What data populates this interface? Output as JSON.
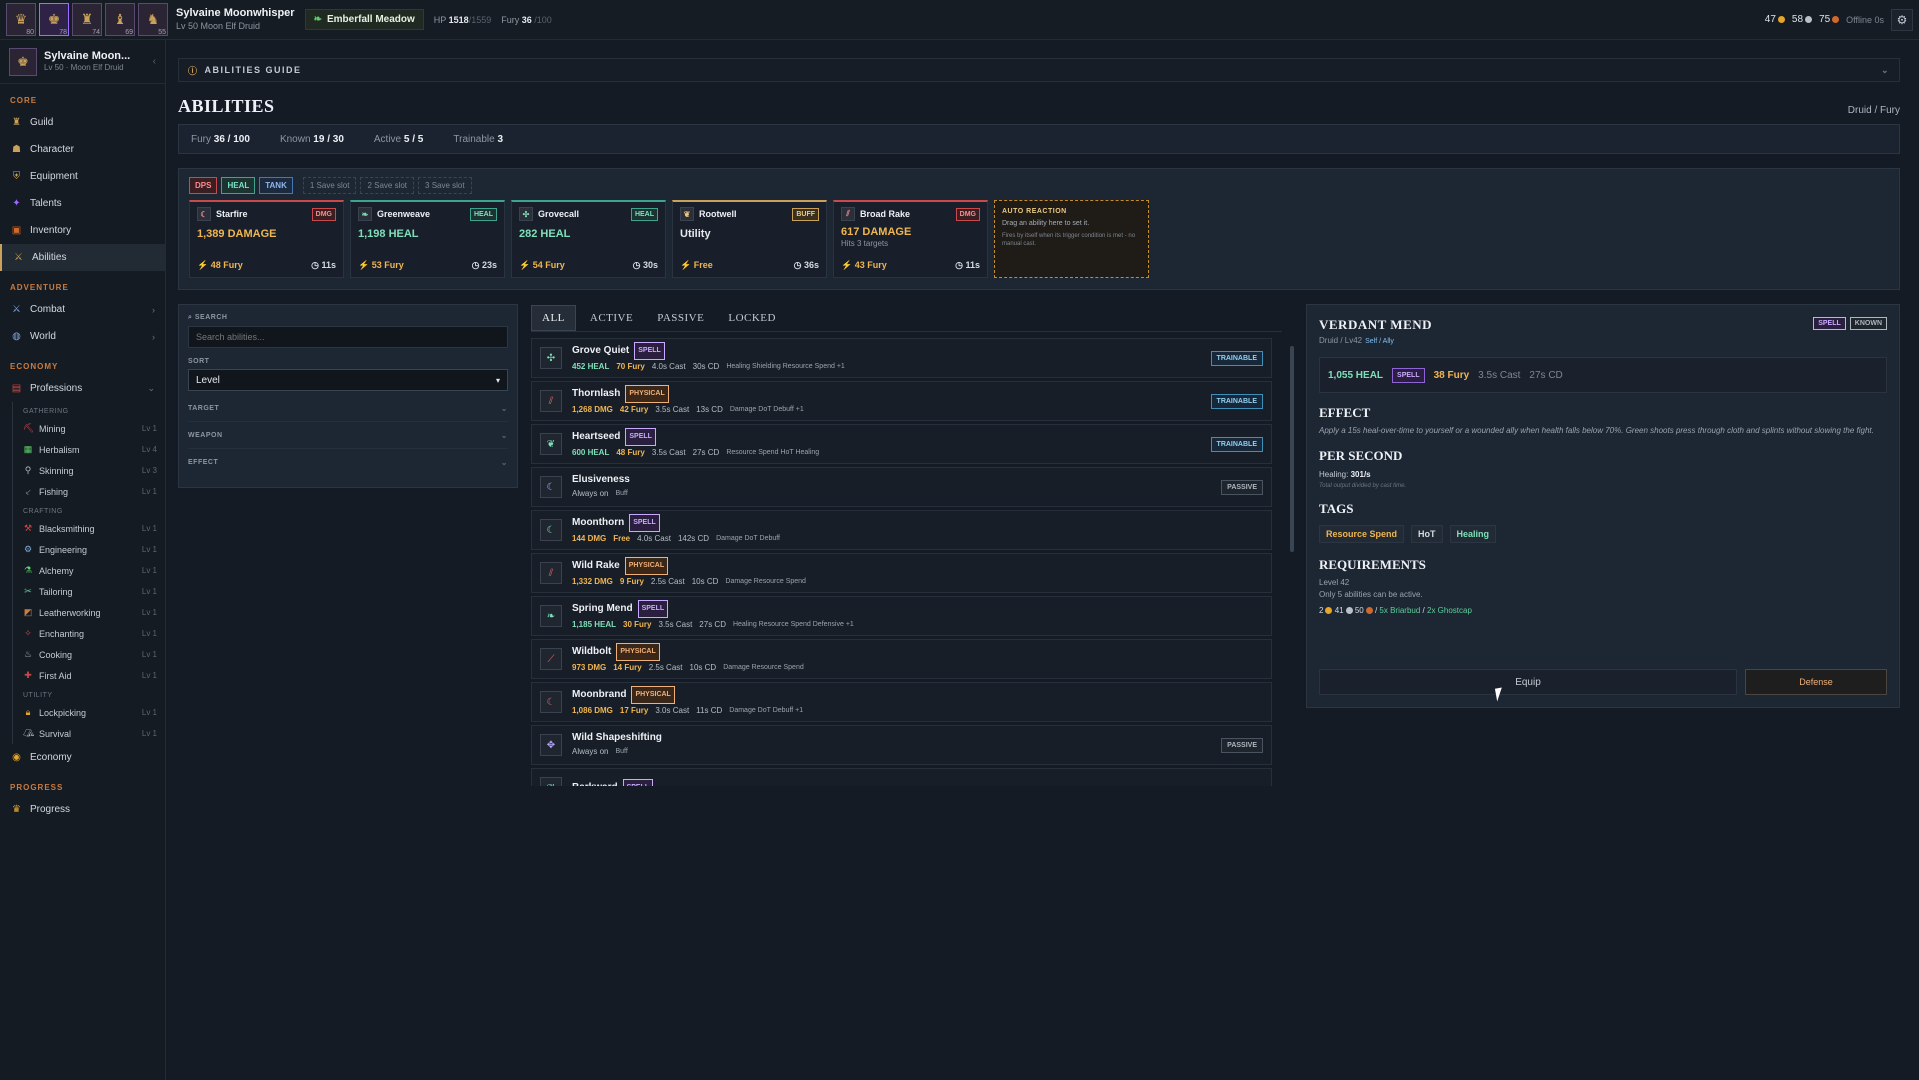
{
  "topbar": {
    "party": [
      {
        "lv": "80",
        "icon": "♛"
      },
      {
        "lv": "78",
        "icon": "♚"
      },
      {
        "lv": "74",
        "icon": "♜"
      },
      {
        "lv": "69",
        "icon": "♝"
      },
      {
        "lv": "55",
        "icon": "♞"
      }
    ],
    "char_name": "Sylvaine Moonwhisper",
    "char_sub": "Lv 50 Moon Elf Druid",
    "zone": "Emberfall Meadow",
    "hp_label": "HP",
    "hp_value": "1518",
    "hp_max": "/1559",
    "fury_label": "Fury",
    "fury_value": "36",
    "fury_max": "/100",
    "gold": "47",
    "silver": "58",
    "copper": "75",
    "offline": "Offline 0s"
  },
  "sidebar": {
    "name": "Sylvaine Moon...",
    "sub": "Lv 50 · Moon Elf Druid",
    "sections": {
      "core": "CORE",
      "adventure": "ADVENTURE",
      "economy": "ECONOMY",
      "progress": "PROGRESS"
    },
    "core_items": [
      "Guild",
      "Character",
      "Equipment",
      "Talents",
      "Inventory",
      "Abilities"
    ],
    "adventure_items": [
      "Combat",
      "World"
    ],
    "professions_label": "Professions",
    "gathering_label": "GATHERING",
    "gathering": [
      {
        "name": "Mining",
        "lv": "Lv 1"
      },
      {
        "name": "Herbalism",
        "lv": "Lv 4"
      },
      {
        "name": "Skinning",
        "lv": "Lv 3"
      },
      {
        "name": "Fishing",
        "lv": "Lv 1"
      }
    ],
    "crafting_label": "CRAFTING",
    "crafting": [
      {
        "name": "Blacksmithing",
        "lv": "Lv 1"
      },
      {
        "name": "Engineering",
        "lv": "Lv 1"
      },
      {
        "name": "Alchemy",
        "lv": "Lv 1"
      },
      {
        "name": "Tailoring",
        "lv": "Lv 1"
      },
      {
        "name": "Leatherworking",
        "lv": "Lv 1"
      },
      {
        "name": "Enchanting",
        "lv": "Lv 1"
      },
      {
        "name": "Cooking",
        "lv": "Lv 1"
      },
      {
        "name": "First Aid",
        "lv": "Lv 1"
      }
    ],
    "utility_label": "UTILITY",
    "utility": [
      {
        "name": "Lockpicking",
        "lv": "Lv 1"
      },
      {
        "name": "Survival",
        "lv": "Lv 1"
      }
    ],
    "economy_item": "Economy",
    "progress_item": "Progress"
  },
  "main": {
    "guide": "ABILITIES GUIDE",
    "title": "ABILITIES",
    "crumb": "Druid / Fury",
    "stats": {
      "fury_label": "Fury",
      "fury": "36 / 100",
      "known_label": "Known",
      "known": "19 / 30",
      "active_label": "Active",
      "active": "5 / 5",
      "trainable_label": "Trainable",
      "trainable": "3"
    },
    "roles": [
      "DPS",
      "HEAL",
      "TANK"
    ],
    "saves": [
      "1  Save slot",
      "2  Save slot",
      "3  Save slot"
    ],
    "slots": [
      {
        "name": "Starfire",
        "tag": "DMG",
        "val": "1,389 DAMAGE",
        "extra": "",
        "cost": "⚡ 48 Fury",
        "cd": "◷ 11s"
      },
      {
        "name": "Greenweave",
        "tag": "HEAL",
        "val": "1,198 HEAL",
        "extra": "",
        "cost": "⚡ 53 Fury",
        "cd": "◷ 23s"
      },
      {
        "name": "Grovecall",
        "tag": "HEAL",
        "val": "282 HEAL",
        "extra": "",
        "cost": "⚡ 54 Fury",
        "cd": "◷ 30s"
      },
      {
        "name": "Rootwell",
        "tag": "BUFF",
        "val": "Utility",
        "extra": "",
        "cost": "⚡ Free",
        "cd": "◷ 36s"
      },
      {
        "name": "Broad Rake",
        "tag": "DMG",
        "val": "617 DAMAGE",
        "extra": "Hits 3 targets",
        "cost": "⚡ 43 Fury",
        "cd": "◷ 11s"
      }
    ],
    "auto": {
      "title": "AUTO REACTION",
      "desc": "Drag an ability here to set it.",
      "desc2": "Fires by itself when its trigger condition is met - no manual cast."
    },
    "filters": {
      "search_label": "SEARCH",
      "search_placeholder": "Search abilities...",
      "sort_label": "SORT",
      "sort_value": "Level",
      "target": "TARGET",
      "weapon": "WEAPON",
      "effect": "EFFECT"
    },
    "tabs": [
      "ALL",
      "ACTIVE",
      "PASSIVE",
      "LOCKED"
    ],
    "abilities": [
      {
        "name": "Grove Quiet",
        "kind": "SPELL",
        "val": "452 HEAL",
        "fury": "70 Fury",
        "cast": "4.0s Cast",
        "cd": "30s CD",
        "tags": "Healing   Shielding   Resource Spend   +1",
        "right": "TRAINABLE",
        "icon": "✣"
      },
      {
        "name": "Thornlash",
        "kind": "PHYSICAL",
        "val": "1,268 DMG",
        "fury": "42 Fury",
        "cast": "3.5s Cast",
        "cd": "13s CD",
        "tags": "Damage   DoT   Debuff   +1",
        "right": "TRAINABLE",
        "icon": "⫽"
      },
      {
        "name": "Heartseed",
        "kind": "SPELL",
        "val": "600 HEAL",
        "fury": "48 Fury",
        "cast": "3.5s Cast",
        "cd": "27s CD",
        "tags": "Resource Spend   HoT   Healing",
        "right": "TRAINABLE",
        "icon": "❦"
      },
      {
        "name": "Elusiveness",
        "kind": "",
        "val": "",
        "fury": "",
        "cast": "Always on",
        "cd": "",
        "tags": "Buff",
        "right": "PASSIVE",
        "icon": "☾"
      },
      {
        "name": "Moonthorn",
        "kind": "SPELL",
        "val": "144 DMG",
        "fury": "Free",
        "cast": "4.0s Cast",
        "cd": "142s CD",
        "tags": "Damage   DoT   Debuff",
        "right": "",
        "icon": "☾"
      },
      {
        "name": "Wild Rake",
        "kind": "PHYSICAL",
        "val": "1,332 DMG",
        "fury": "9 Fury",
        "cast": "2.5s Cast",
        "cd": "10s CD",
        "tags": "Damage   Resource Spend",
        "right": "",
        "icon": "⫽"
      },
      {
        "name": "Spring Mend",
        "kind": "SPELL",
        "val": "1,185 HEAL",
        "fury": "30 Fury",
        "cast": "3.5s Cast",
        "cd": "27s CD",
        "tags": "Healing   Resource Spend   Defensive   +1",
        "right": "",
        "icon": "❧"
      },
      {
        "name": "Wildbolt",
        "kind": "PHYSICAL",
        "val": "973 DMG",
        "fury": "14 Fury",
        "cast": "2.5s Cast",
        "cd": "10s CD",
        "tags": "Damage   Resource Spend",
        "right": "",
        "icon": "⟋"
      },
      {
        "name": "Moonbrand",
        "kind": "PHYSICAL",
        "val": "1,086 DMG",
        "fury": "17 Fury",
        "cast": "3.0s Cast",
        "cd": "11s CD",
        "tags": "Damage   DoT   Debuff   +1",
        "right": "",
        "icon": "☾"
      },
      {
        "name": "Wild Shapeshifting",
        "kind": "",
        "val": "",
        "fury": "",
        "cast": "Always on",
        "cd": "",
        "tags": "Buff",
        "right": "PASSIVE",
        "icon": "✥"
      },
      {
        "name": "Barkward",
        "kind": "SPELL",
        "val": "",
        "fury": "",
        "cast": "",
        "cd": "",
        "tags": "",
        "right": "",
        "icon": "❦"
      }
    ],
    "detail": {
      "title": "VERDANT MEND",
      "kind": "SPELL",
      "status": "KNOWN",
      "meta": "Druid / Lv42",
      "target": "Self / Ally",
      "heal": "1,055 HEAL",
      "spell": "SPELL",
      "fury": "38 Fury",
      "cast": "3.5s Cast",
      "cd": "27s CD",
      "effect_h": "EFFECT",
      "effect": "Apply a 15s heal-over-time to yourself or a wounded ally when health falls below 70%. Green shoots press through cloth and splints without slowing the fight.",
      "ps_h": "PER SECOND",
      "ps_label": "Healing:",
      "ps_val": "301/s",
      "ps_note": "Total output divided by cast time.",
      "tags_h": "TAGS",
      "tags": [
        "Resource Spend",
        "HoT",
        "Healing"
      ],
      "req_h": "REQUIREMENTS",
      "req_level": "Level 42",
      "req_note": "Only 5 abilities can be active.",
      "cost_g": "2",
      "cost_s": "41",
      "cost_c": "50",
      "mat1": "5x Briarbud",
      "mat2": "2x Ghostcap",
      "equip": "Equip",
      "defense": "Defense"
    }
  }
}
